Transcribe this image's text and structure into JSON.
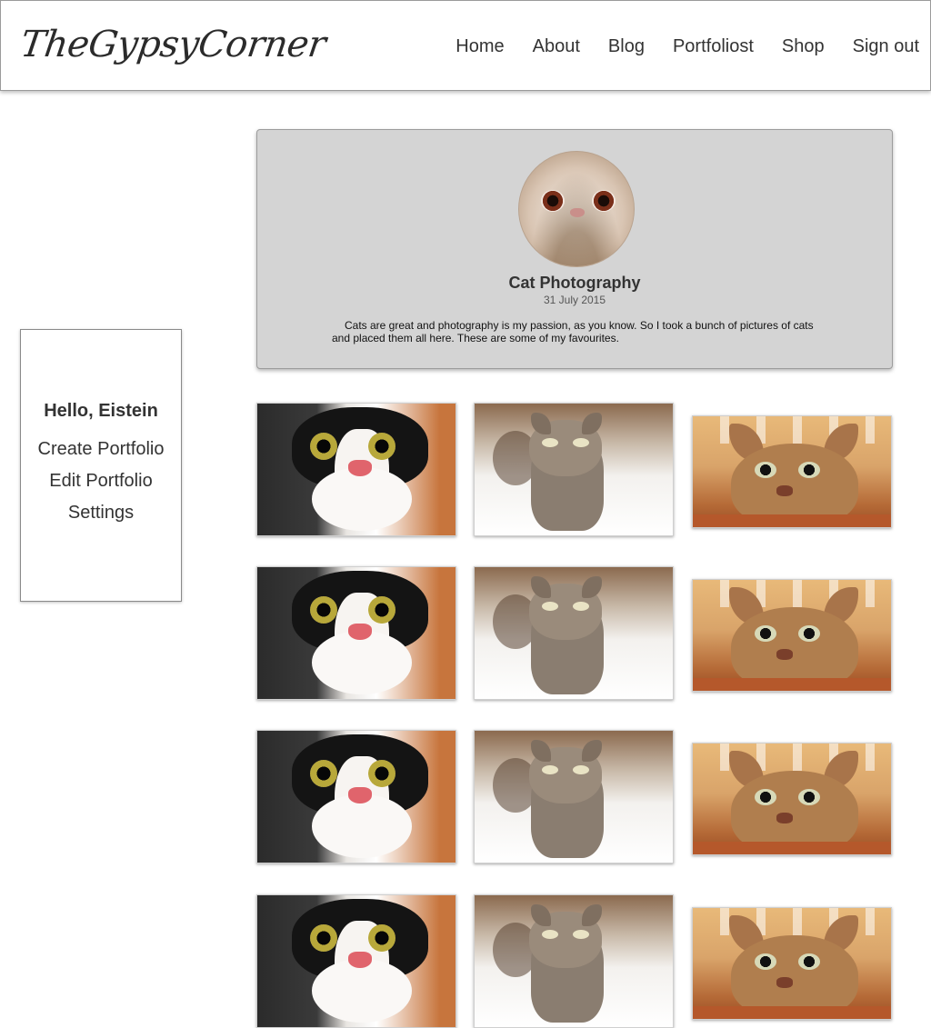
{
  "header": {
    "logo": "TheGypsyCorner",
    "nav": [
      "Home",
      "About",
      "Blog",
      "Portfoliost",
      "Shop",
      "Sign out"
    ]
  },
  "sidebar": {
    "greeting": "Hello, Eistein",
    "links": [
      "Create Portfolio",
      "Edit Portfolio",
      "Settings"
    ]
  },
  "profile": {
    "title": "Cat Photography",
    "date": "31 July 2015",
    "description": "Cats are great and photography is my passion, as you know. So I took a bunch of pictures of cats and placed them all here. These are some of my favourites."
  },
  "gallery": {
    "rows": 4,
    "columns": [
      "black-white-cat",
      "tabby-cat-on-bed",
      "tabby-cat-at-table"
    ]
  }
}
